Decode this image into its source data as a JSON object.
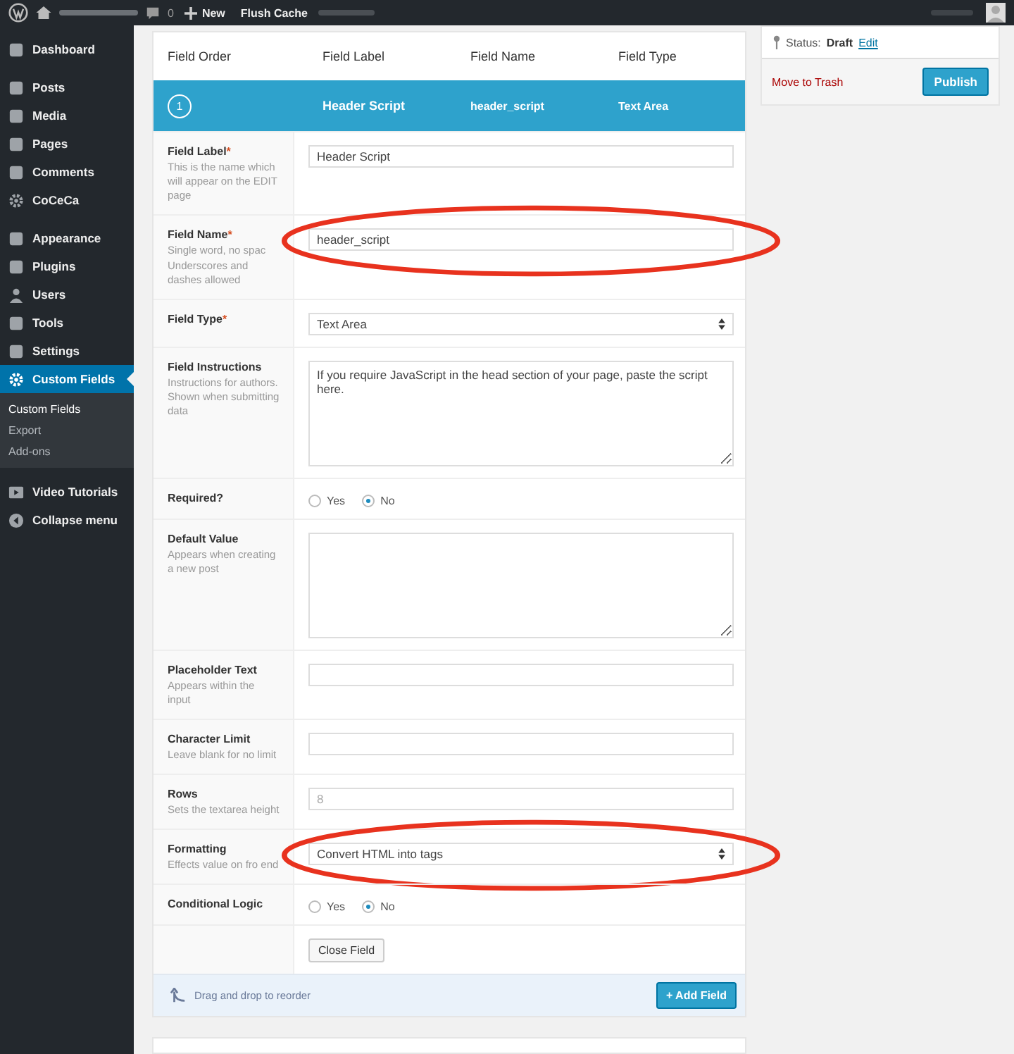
{
  "top_bar": {
    "comments_count": "0",
    "new_label": "New",
    "links": [
      "Flush Cache"
    ]
  },
  "sidebar": {
    "groups": [
      [
        {
          "label": "Dashboard",
          "selected": false
        }
      ],
      [
        {
          "label": "Posts",
          "selected": false
        },
        {
          "label": "Media",
          "selected": false
        },
        {
          "label": "Pages",
          "selected": false
        },
        {
          "label": "Comments",
          "selected": false
        },
        {
          "label": "CoCeCa",
          "selected": false
        }
      ],
      [
        {
          "label": "Appearance",
          "selected": false
        },
        {
          "label": "Plugins",
          "selected": false
        },
        {
          "label": "Users",
          "selected": false
        },
        {
          "label": "Tools",
          "selected": false
        },
        {
          "label": "Settings",
          "selected": false
        },
        {
          "label": "Custom Fields",
          "selected": true,
          "children": [
            {
              "label": "Custom Fields",
              "selected": true
            },
            {
              "label": "Export",
              "selected": false
            },
            {
              "label": "Add-ons",
              "selected": false
            }
          ]
        }
      ],
      [
        {
          "label": "Video Tutorials",
          "selected": false
        },
        {
          "label": "Collapse menu",
          "selected": false
        }
      ]
    ]
  },
  "fields_table": {
    "columns": [
      "Field Order",
      "Field Label",
      "Field Name",
      "Field Type"
    ],
    "active_field": {
      "order": "1",
      "label": "Header Script",
      "name": "header_script",
      "type": "Text Area"
    },
    "settings": [
      {
        "kind": "text",
        "label": "Field Label",
        "required": true,
        "description": "This is the name which will appear on the EDIT page",
        "value": "Header Script"
      },
      {
        "kind": "text",
        "label": "Field Name",
        "required": true,
        "description": "Single word, no spac Underscores and dashes allowed",
        "value": "header_script",
        "highlighted": true
      },
      {
        "kind": "select",
        "label": "Field Type",
        "required": true,
        "value": "Text Area"
      },
      {
        "kind": "textarea",
        "label": "Field Instructions",
        "required": false,
        "description": "Instructions for authors. Shown when submitting data",
        "value": "If you require JavaScript in the head section of your page, paste the script here."
      },
      {
        "kind": "radio",
        "label": "Required?",
        "required": false,
        "options": [
          {
            "label": "Yes",
            "selected": false
          },
          {
            "label": "No",
            "selected": true
          }
        ]
      },
      {
        "kind": "textarea",
        "label": "Default Value",
        "required": false,
        "description": "Appears when creating a new post"
      },
      {
        "kind": "text",
        "label": "Placeholder Text",
        "required": false,
        "description": "Appears within the input"
      },
      {
        "kind": "text",
        "label": "Character Limit",
        "required": false,
        "description": "Leave blank for no limit"
      },
      {
        "kind": "text",
        "label": "Rows",
        "required": false,
        "description": "Sets the textarea height",
        "placeholder": "8"
      },
      {
        "kind": "select",
        "label": "Formatting",
        "required": false,
        "description": "Effects value on fro end",
        "value": "Convert HTML into tags",
        "highlighted": true
      },
      {
        "kind": "radio",
        "label": "Conditional Logic",
        "required": false,
        "options": [
          {
            "label": "Yes",
            "selected": false
          },
          {
            "label": "No",
            "selected": true
          }
        ]
      },
      {
        "kind": "button",
        "value": "Close Field"
      }
    ],
    "footer": {
      "hint": "Drag and drop to reorder",
      "button": "+ Add Field"
    }
  },
  "required_marker": "*",
  "publish_box": {
    "status_label": "Status:",
    "status": "Draft",
    "edit_link": "Edit",
    "trash_link": "Move to Trash",
    "button": "Publish"
  }
}
